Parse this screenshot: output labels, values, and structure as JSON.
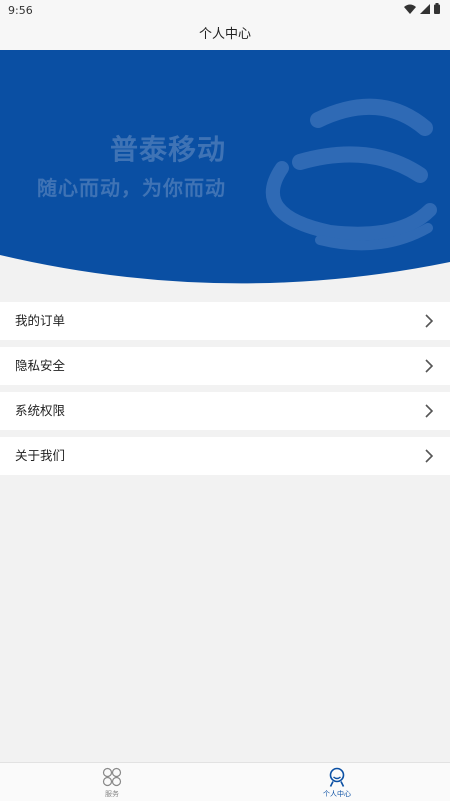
{
  "status_bar": {
    "time": "9:56",
    "icons": [
      "wifi-icon",
      "signal-icon",
      "battery-icon"
    ]
  },
  "header": {
    "title": "个人中心"
  },
  "banner": {
    "line1": "普泰移动",
    "line2": "随心而动，为你而动",
    "colors": {
      "background": "#0a4fa3",
      "text": "#3f73b5"
    }
  },
  "menu": {
    "items": [
      {
        "label": "我的订单"
      },
      {
        "label": "隐私安全"
      },
      {
        "label": "系统权限"
      },
      {
        "label": "关于我们"
      }
    ]
  },
  "tab_bar": {
    "tabs": [
      {
        "label": "服务",
        "icon": "apps-icon",
        "active": false
      },
      {
        "label": "个人中心",
        "icon": "person-icon",
        "active": true
      }
    ],
    "colors": {
      "active": "#0a4fa3",
      "inactive": "#888888"
    }
  }
}
